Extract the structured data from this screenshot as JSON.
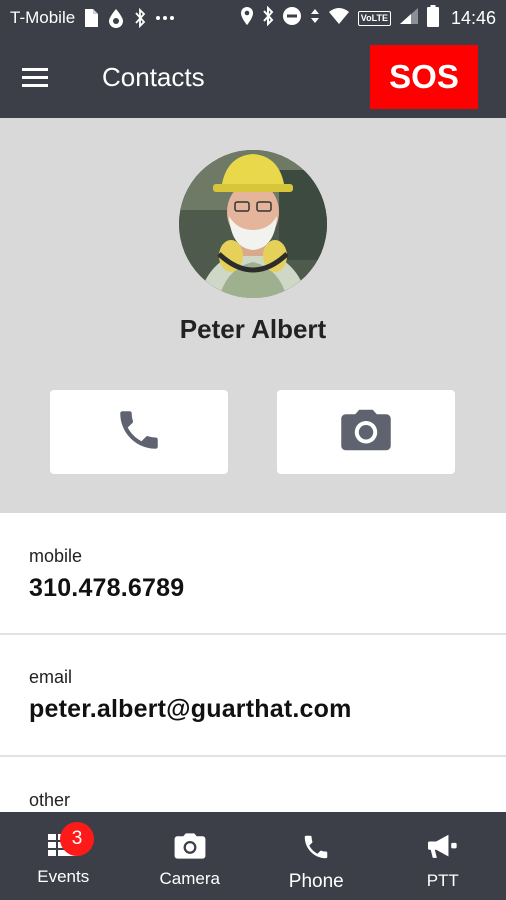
{
  "status_bar": {
    "carrier": "T-Mobile",
    "network_badge": "VoLTE",
    "time": "14:46"
  },
  "app_bar": {
    "title": "Contacts",
    "sos_label": "SOS"
  },
  "contact": {
    "name": "Peter Albert"
  },
  "details": [
    {
      "label": "mobile",
      "value": "310.478.6789"
    },
    {
      "label": "email",
      "value": "peter.albert@guarthat.com"
    },
    {
      "label": "other",
      "value": ""
    }
  ],
  "bottom_nav": {
    "events_label": "Events",
    "events_badge": "3",
    "camera_label": "Camera",
    "phone_label": "Phone",
    "ptt_label": "PTT"
  },
  "colors": {
    "bar_background": "#3c3f48",
    "sos_red": "#ff0000",
    "header_grey": "#d9d9d9",
    "icon_grey": "#5f6370"
  }
}
